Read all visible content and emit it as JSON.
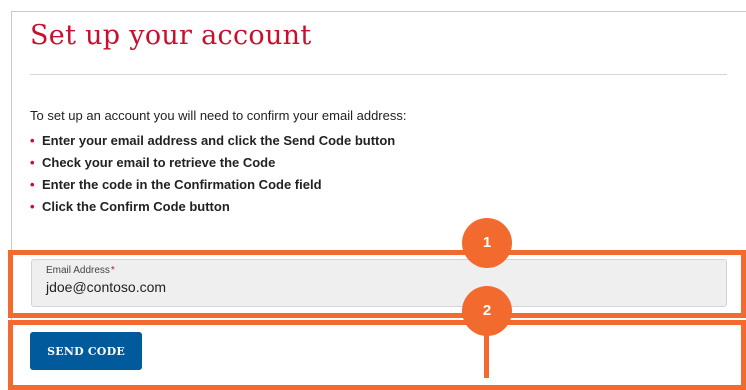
{
  "page": {
    "title": "Set up your account",
    "intro": "To set up an account you will need to confirm your email address:",
    "steps": [
      {
        "bullet": "•",
        "text": "Enter your email address and click the Send Code button"
      },
      {
        "bullet": "•",
        "text": "Check your email to retrieve the Code"
      },
      {
        "bullet": "•",
        "text": "Enter the code in the Confirmation Code field"
      },
      {
        "bullet": "•",
        "text": "Click the Confirm Code button"
      }
    ]
  },
  "form": {
    "email_label": "Email Address",
    "required_mark": "*",
    "email_value": "jdoe@contoso.com",
    "send_code_label": "SEND CODE"
  },
  "callouts": [
    {
      "number": "1"
    },
    {
      "number": "2"
    }
  ],
  "colors": {
    "title": "#c8102e",
    "bullet": "#c8102e",
    "button": "#005a9c",
    "callout": "#f26a2e",
    "field_background": "#efefef"
  }
}
